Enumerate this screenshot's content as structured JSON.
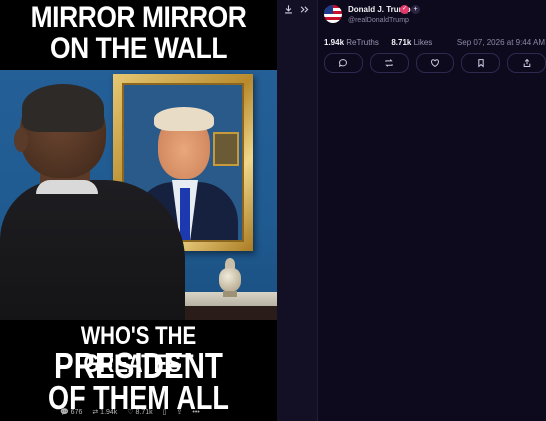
{
  "meme": {
    "top_line1": "MIRROR MIRROR",
    "top_line2": "ON THE WALL",
    "bottom_line1": "WHO'S THE GREATEST",
    "bottom_line2": "PRESIDENT",
    "bottom_line3": "OF THEM ALL"
  },
  "image_overlay": {
    "replies": "676",
    "retruths": "1.94k",
    "likes": "8.71k"
  },
  "toolbar": {
    "download_icon": "download-icon",
    "expand_icon": "double-chevron-right-icon"
  },
  "post": {
    "display_name": "Donald J. Trump",
    "handle": "@realDonaldTrump",
    "verified_icon": "verified-badge-icon",
    "retruths_count": "1.94k",
    "retruths_label": "ReTruths",
    "likes_count": "8.71k",
    "likes_label": "Likes",
    "timestamp": "Sep 07, 2026 at 9:44 AM",
    "actions": [
      "reply-icon",
      "retruth-icon",
      "like-icon",
      "bookmark-icon",
      "share-icon"
    ]
  },
  "colors": {
    "background": "#0d0a1d",
    "verified": "#e23b6b",
    "muted_text": "#8c88a6"
  }
}
